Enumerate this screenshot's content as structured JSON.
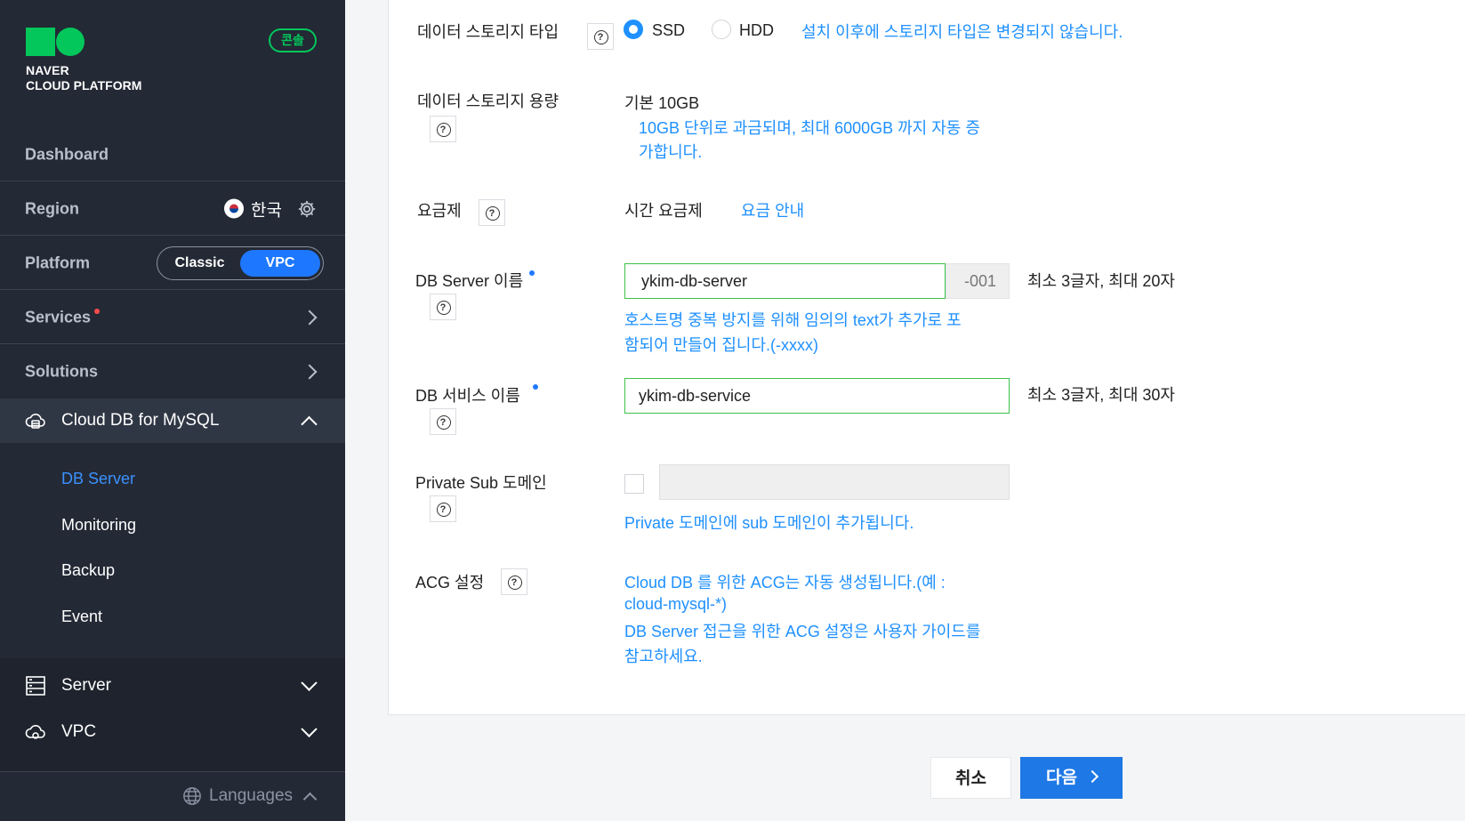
{
  "brand": {
    "line1": "NAVER",
    "line2": "CLOUD PLATFORM",
    "console_badge": "콘솔"
  },
  "sidebar": {
    "dashboard": "Dashboard",
    "region_label": "Region",
    "region_value": "한국",
    "platform_label": "Platform",
    "platform_classic": "Classic",
    "platform_vpc": "VPC",
    "services": "Services",
    "solutions": "Solutions",
    "cloud_db": "Cloud DB for MySQL",
    "submenu": [
      "DB Server",
      "Monitoring",
      "Backup",
      "Event"
    ],
    "server": "Server",
    "vpc": "VPC",
    "languages": "Languages"
  },
  "form": {
    "storage_type": {
      "label": "데이터 스토리지 타입",
      "opt_ssd": "SSD",
      "opt_hdd": "HDD",
      "note": "설치 이후에 스토리지 타입은 변경되지 않습니다.",
      "selected": "SSD"
    },
    "storage_size": {
      "label": "데이터 스토리지 용량",
      "value": "기본 10GB",
      "note_line1": "10GB 단위로 과금되며, 최대 6000GB 까지 자동 증",
      "note_line2": "가합니다."
    },
    "pricing": {
      "label": "요금제",
      "value": "시간 요금제",
      "link": "요금 안내"
    },
    "db_server_name": {
      "label": "DB Server 이름",
      "value": "ykim-db-server",
      "suffix": "-001",
      "limit": "최소 3글자, 최대 20자",
      "note_line1": "호스트명 중복 방지를 위해 임의의 text가 추가로 포",
      "note_line2": "함되어 만들어 집니다.(-xxxx)"
    },
    "db_service_name": {
      "label": "DB 서비스 이름",
      "value": "ykim-db-service",
      "limit": "최소 3글자, 최대 30자"
    },
    "private_sub_domain": {
      "label": "Private Sub 도메인",
      "note": "Private 도메인에 sub 도메인이 추가됩니다."
    },
    "acg": {
      "label": "ACG 설정",
      "note_line1": "Cloud DB 를 위한 ACG는 자동 생성됩니다.(예 :",
      "note_line2": "cloud-mysql-*)",
      "note_line3": "DB Server 접근을 위한 ACG 설정은 사용자 가이드를",
      "note_line4": "참고하세요."
    }
  },
  "help_glyph": "?",
  "buttons": {
    "cancel": "취소",
    "next": "다음"
  },
  "colors": {
    "accent": "#1e90ff",
    "brand_green": "#03c75a",
    "sidebar_bg": "#232935",
    "input_border": "#3cc14a"
  }
}
